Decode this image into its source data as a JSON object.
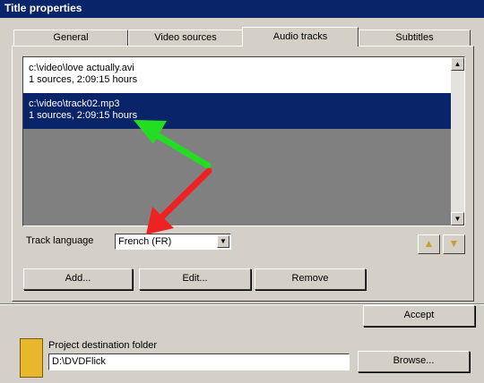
{
  "window": {
    "title": "Title properties"
  },
  "tabs": [
    {
      "label": "General"
    },
    {
      "label": "Video sources"
    },
    {
      "label": "Audio tracks",
      "active": true
    },
    {
      "label": "Subtitles"
    }
  ],
  "audio_tracks": [
    {
      "path": "c:\\video\\love actually.avi",
      "info": "1 sources, 2:09:15 hours",
      "selected": false
    },
    {
      "path": "c:\\video\\track02.mp3",
      "info": "1 sources, 2:09:15 hours",
      "selected": true
    }
  ],
  "track_language": {
    "label": "Track language",
    "value": "French (FR)"
  },
  "move_buttons": {
    "up_icon": "move-up-icon",
    "down_icon": "move-down-icon"
  },
  "actions": {
    "add": "Add...",
    "edit": "Edit...",
    "remove": "Remove",
    "accept": "Accept"
  },
  "background_window": {
    "destination_label": "Project destination folder",
    "destination_value": "D:\\DVDFlick",
    "browse": "Browse..."
  },
  "annotation_colors": {
    "green_arrow": "#22dd22",
    "red_arrow": "#ee2222"
  },
  "colors": {
    "selection": "#0a246a",
    "dialog_face": "#d4d0c8",
    "list_empty": "#808080"
  }
}
